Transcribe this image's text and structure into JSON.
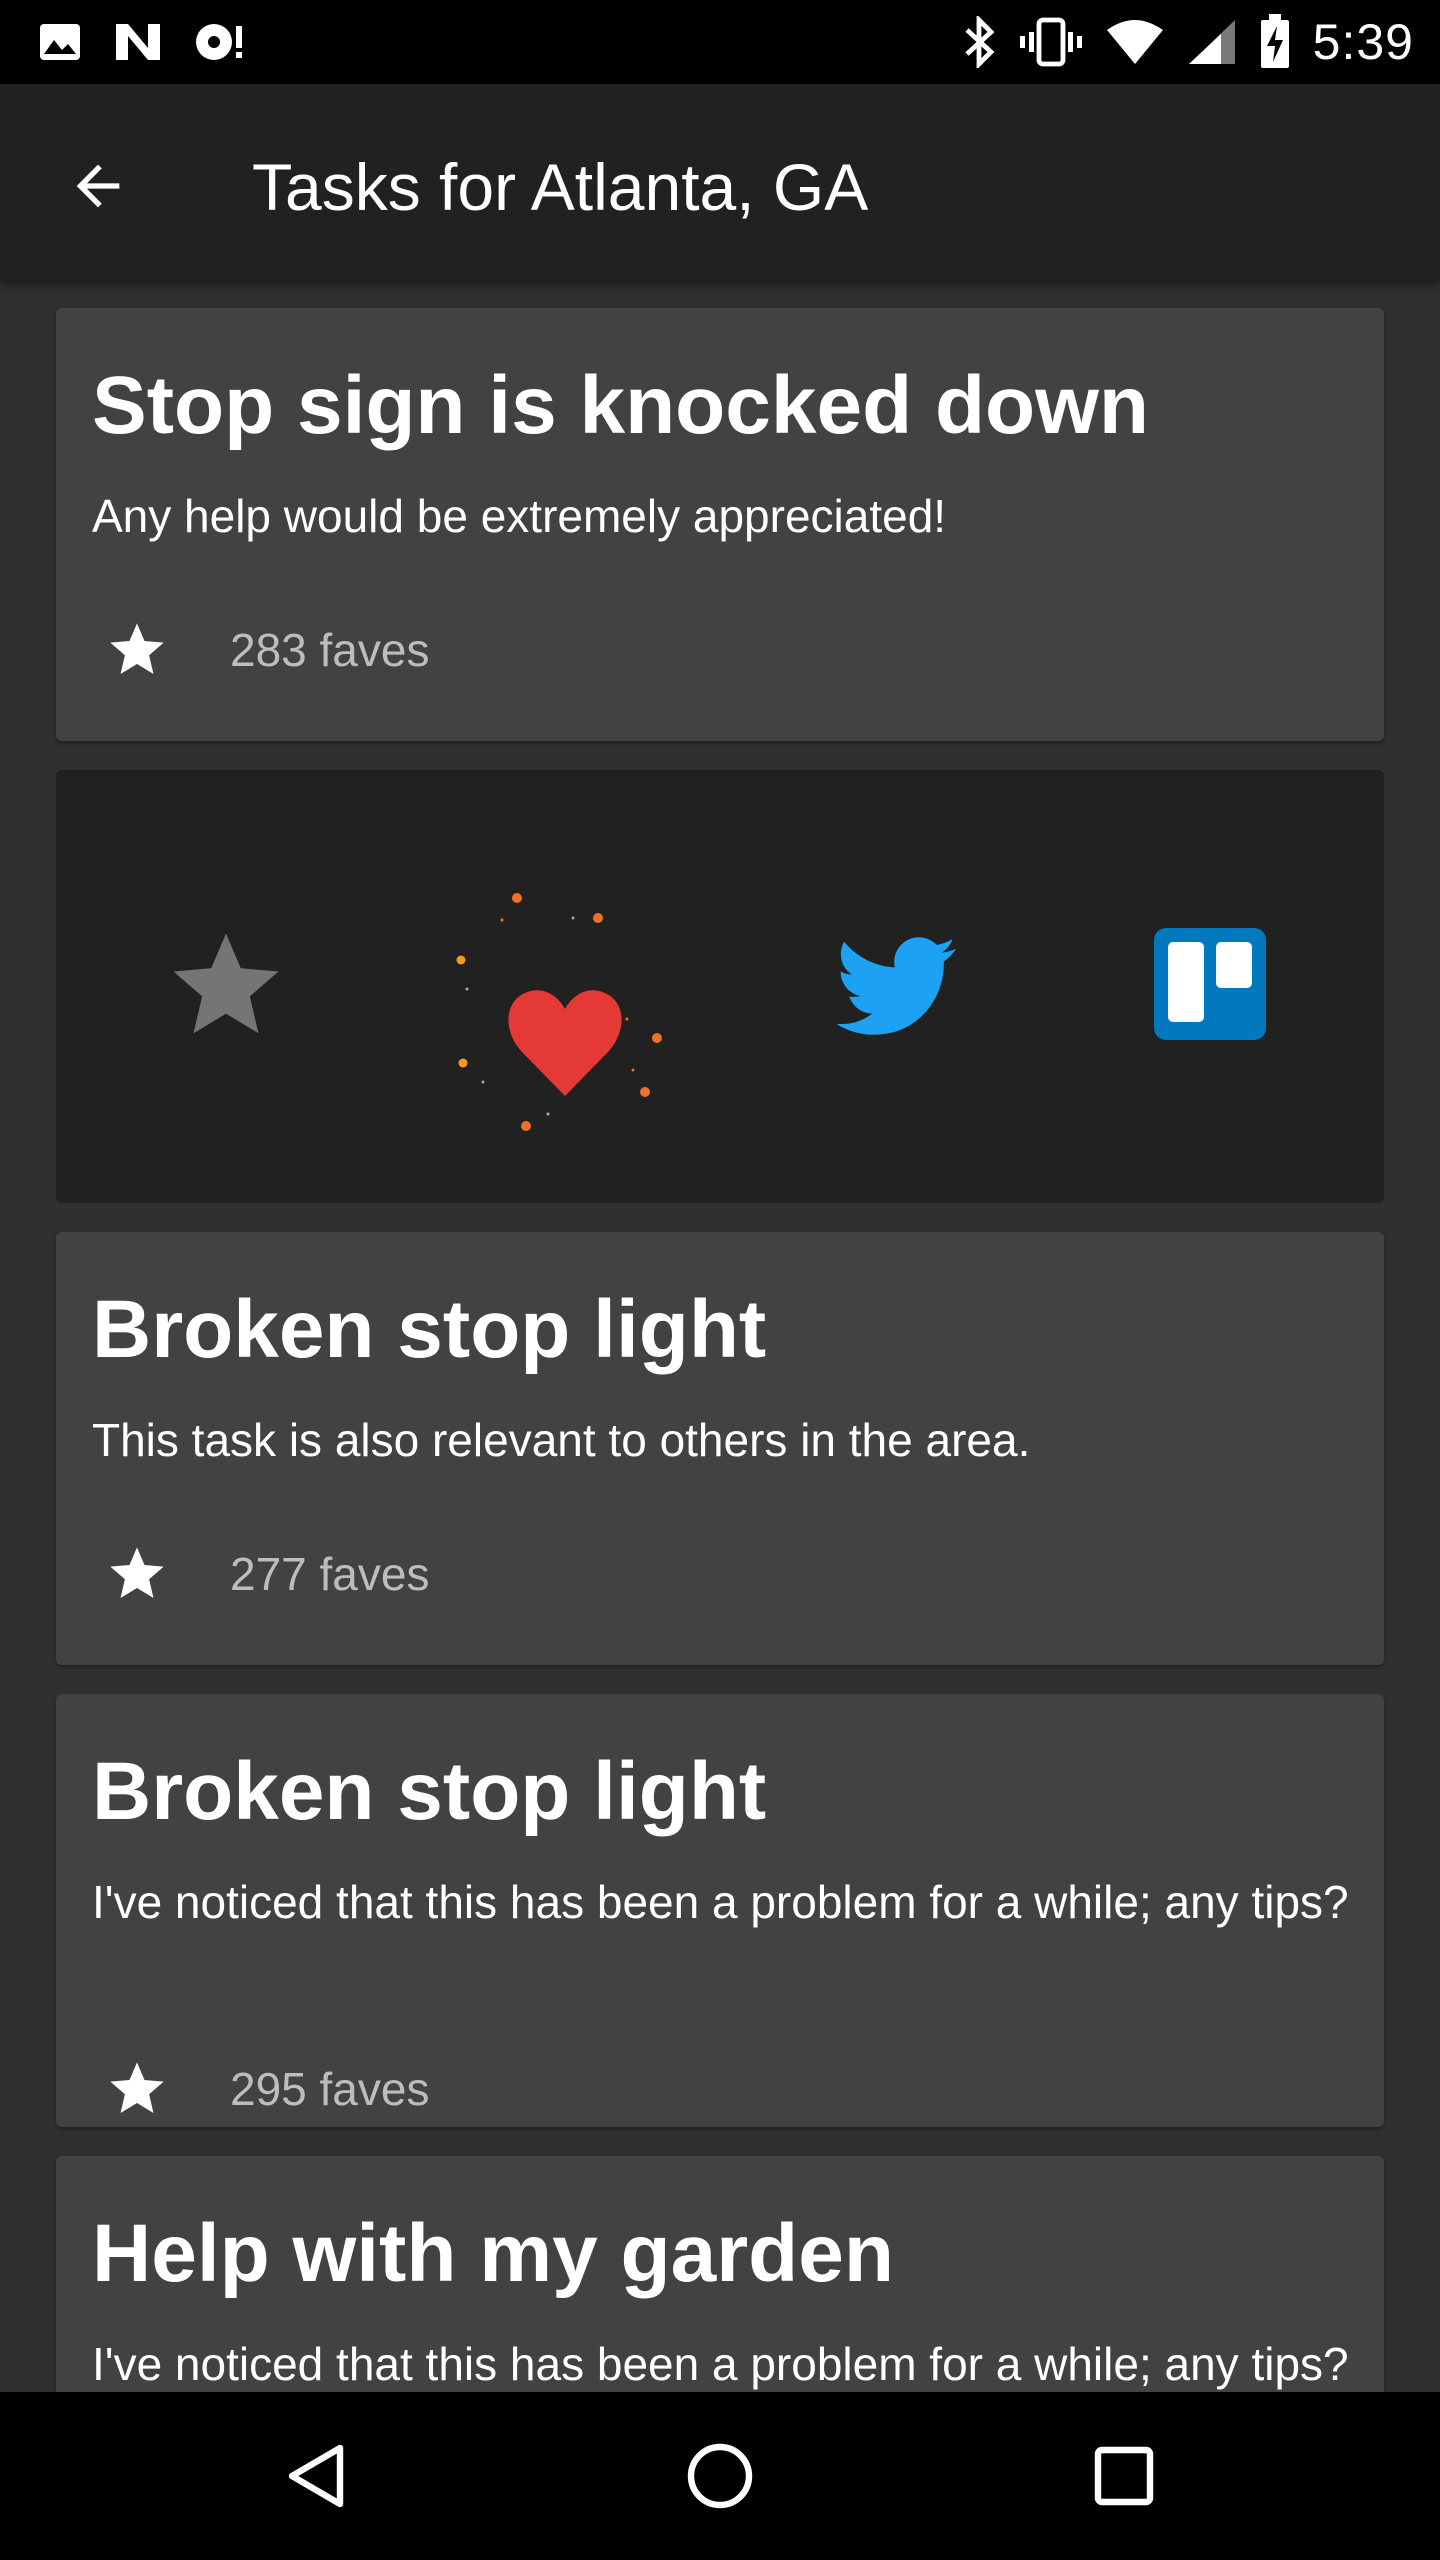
{
  "status_bar": {
    "time": "5:39",
    "left_icons": [
      "image-notification-icon",
      "n-notification-icon",
      "disc-notification-icon"
    ],
    "right_icons": [
      "bluetooth-icon",
      "vibrate-icon",
      "wifi-icon",
      "signal-icon",
      "battery-charging-icon"
    ]
  },
  "toolbar": {
    "title": "Tasks for Atlanta, GA",
    "back_icon": "arrow-back-icon"
  },
  "tasks": [
    {
      "title": "Stop sign is knocked down",
      "description": "Any help would be extremely appreciated!",
      "faves": "283 faves"
    },
    {
      "title": "Broken stop light",
      "description": "This task is also relevant to others in the area.",
      "faves": "277 faves"
    },
    {
      "title": "Broken stop light",
      "description": "I've noticed that this has been a problem for a while; any tips?",
      "faves": "295 faves"
    },
    {
      "title": "Help with my garden",
      "description": "I've noticed that this has been a problem for a while; any tips?",
      "faves": ""
    }
  ],
  "share_bar": {
    "icons": [
      "star-icon",
      "heart-icon",
      "twitter-icon",
      "trello-icon"
    ],
    "colors": {
      "star": "#757575",
      "heart": "#e53935",
      "twitter": "#1da1f2",
      "trello": "#0079bf",
      "sparkle": "#f0702a"
    }
  },
  "nav_bar": {
    "icons": [
      "back-triangle-icon",
      "home-circle-icon",
      "recents-square-icon"
    ]
  },
  "colors": {
    "background": "#303030",
    "card": "#424242",
    "toolbar": "#212121",
    "status_bar": "#000000"
  }
}
